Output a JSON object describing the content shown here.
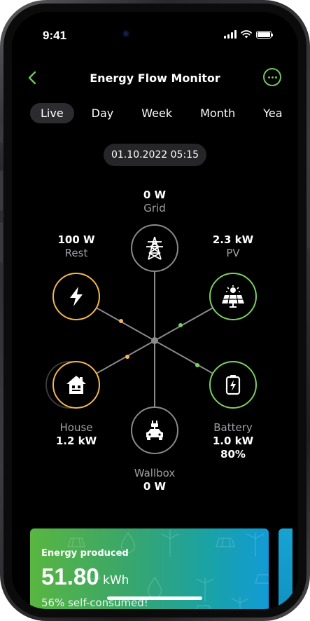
{
  "status_bar": {
    "time": "9:41"
  },
  "header": {
    "title": "Energy Flow Monitor"
  },
  "tabs": [
    {
      "label": "Live",
      "active": true
    },
    {
      "label": "Day"
    },
    {
      "label": "Week"
    },
    {
      "label": "Month"
    },
    {
      "label": "Yea"
    }
  ],
  "timestamp": "01.10.2022 05:15",
  "nodes": {
    "grid": {
      "value": "0 W",
      "name": "Grid",
      "icon": "power-tower-icon",
      "color": "#8a8a8c"
    },
    "pv": {
      "value": "2.3 kW",
      "name": "PV",
      "icon": "solar-panel-icon",
      "color": "#7bd160"
    },
    "rest": {
      "value": "100 W",
      "name": "Rest",
      "icon": "lightning-icon",
      "color": "#f2b94d"
    },
    "house": {
      "name": "House",
      "value": "1.2 kW",
      "icon": "house-icon",
      "color": "#f2b94d"
    },
    "battery": {
      "name": "Battery",
      "value": "1.0 kW",
      "soc": "80%",
      "icon": "battery-icon",
      "color": "#7bd160"
    },
    "wallbox": {
      "name": "Wallbox",
      "value": "0 W",
      "icon": "car-charger-icon",
      "color": "#8a8a8c"
    }
  },
  "energy_card": {
    "label": "Energy produced",
    "value": "51.80",
    "unit": "kWh",
    "subtitle": "56% self-consumed!"
  },
  "colors": {
    "accent_green": "#74c55e",
    "orange": "#f2b94d",
    "gray": "#8a8a8c"
  }
}
